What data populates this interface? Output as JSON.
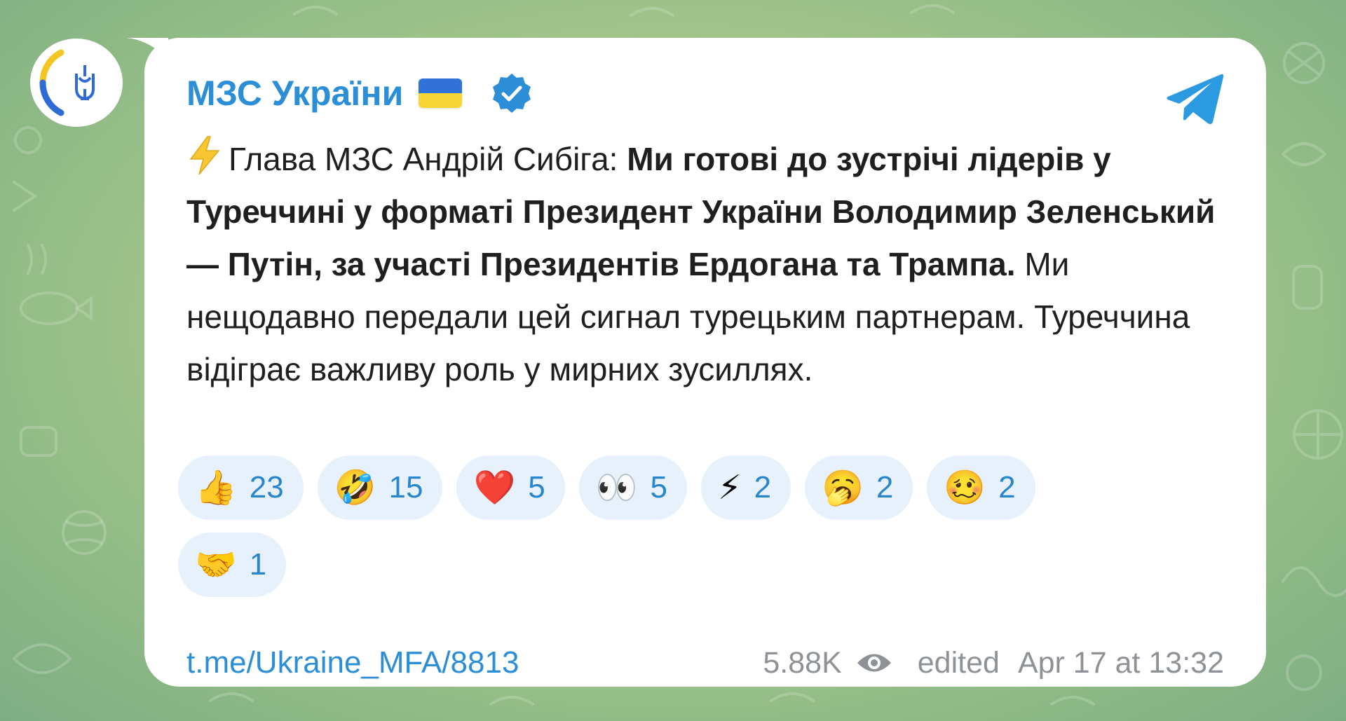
{
  "channel": {
    "name": "МЗС України",
    "flag_icon": "ukraine-flag-icon",
    "verified_icon": "verified-badge-icon",
    "share_icon": "telegram-share-icon"
  },
  "message": {
    "lead_icon": "lightning-icon",
    "prefix": "Глава МЗС Андрій Сибіга: ",
    "bold": "Ми готові до зустрічі лідерів у Туреччині у форматі Президент України Володимир Зеленський — Путін, за участі Президентів Ердогана та Трампа.",
    "rest": " Ми нещодавно передали цей сигнал турецьким партнерам. Туреччина відіграє важливу роль у мирних зусиллях."
  },
  "reactions": [
    {
      "emoji": "👍",
      "icon": "thumbs-up-icon",
      "count": "23"
    },
    {
      "emoji": "🤣",
      "icon": "rofl-face-icon",
      "count": "15"
    },
    {
      "emoji": "❤️",
      "icon": "red-heart-icon",
      "count": "5"
    },
    {
      "emoji": "👀",
      "icon": "eyes-icon",
      "count": "5"
    },
    {
      "emoji": "⚡",
      "icon": "lightning-icon",
      "count": "2"
    },
    {
      "emoji": "🥱",
      "icon": "yawning-face-icon",
      "count": "2"
    },
    {
      "emoji": "🥴",
      "icon": "woozy-face-icon",
      "count": "2"
    },
    {
      "emoji": "🤝",
      "icon": "handshake-icon",
      "count": "1"
    }
  ],
  "footer": {
    "link": "t.me/Ukraine_MFA/8813",
    "views": "5.88K",
    "views_icon": "eye-icon",
    "edited": "edited",
    "timestamp": "Apr 17 at 13:32"
  },
  "colors": {
    "accent": "#2c8ed6",
    "reaction_bg": "#e6f1fb",
    "meta_text": "#8e9296"
  }
}
